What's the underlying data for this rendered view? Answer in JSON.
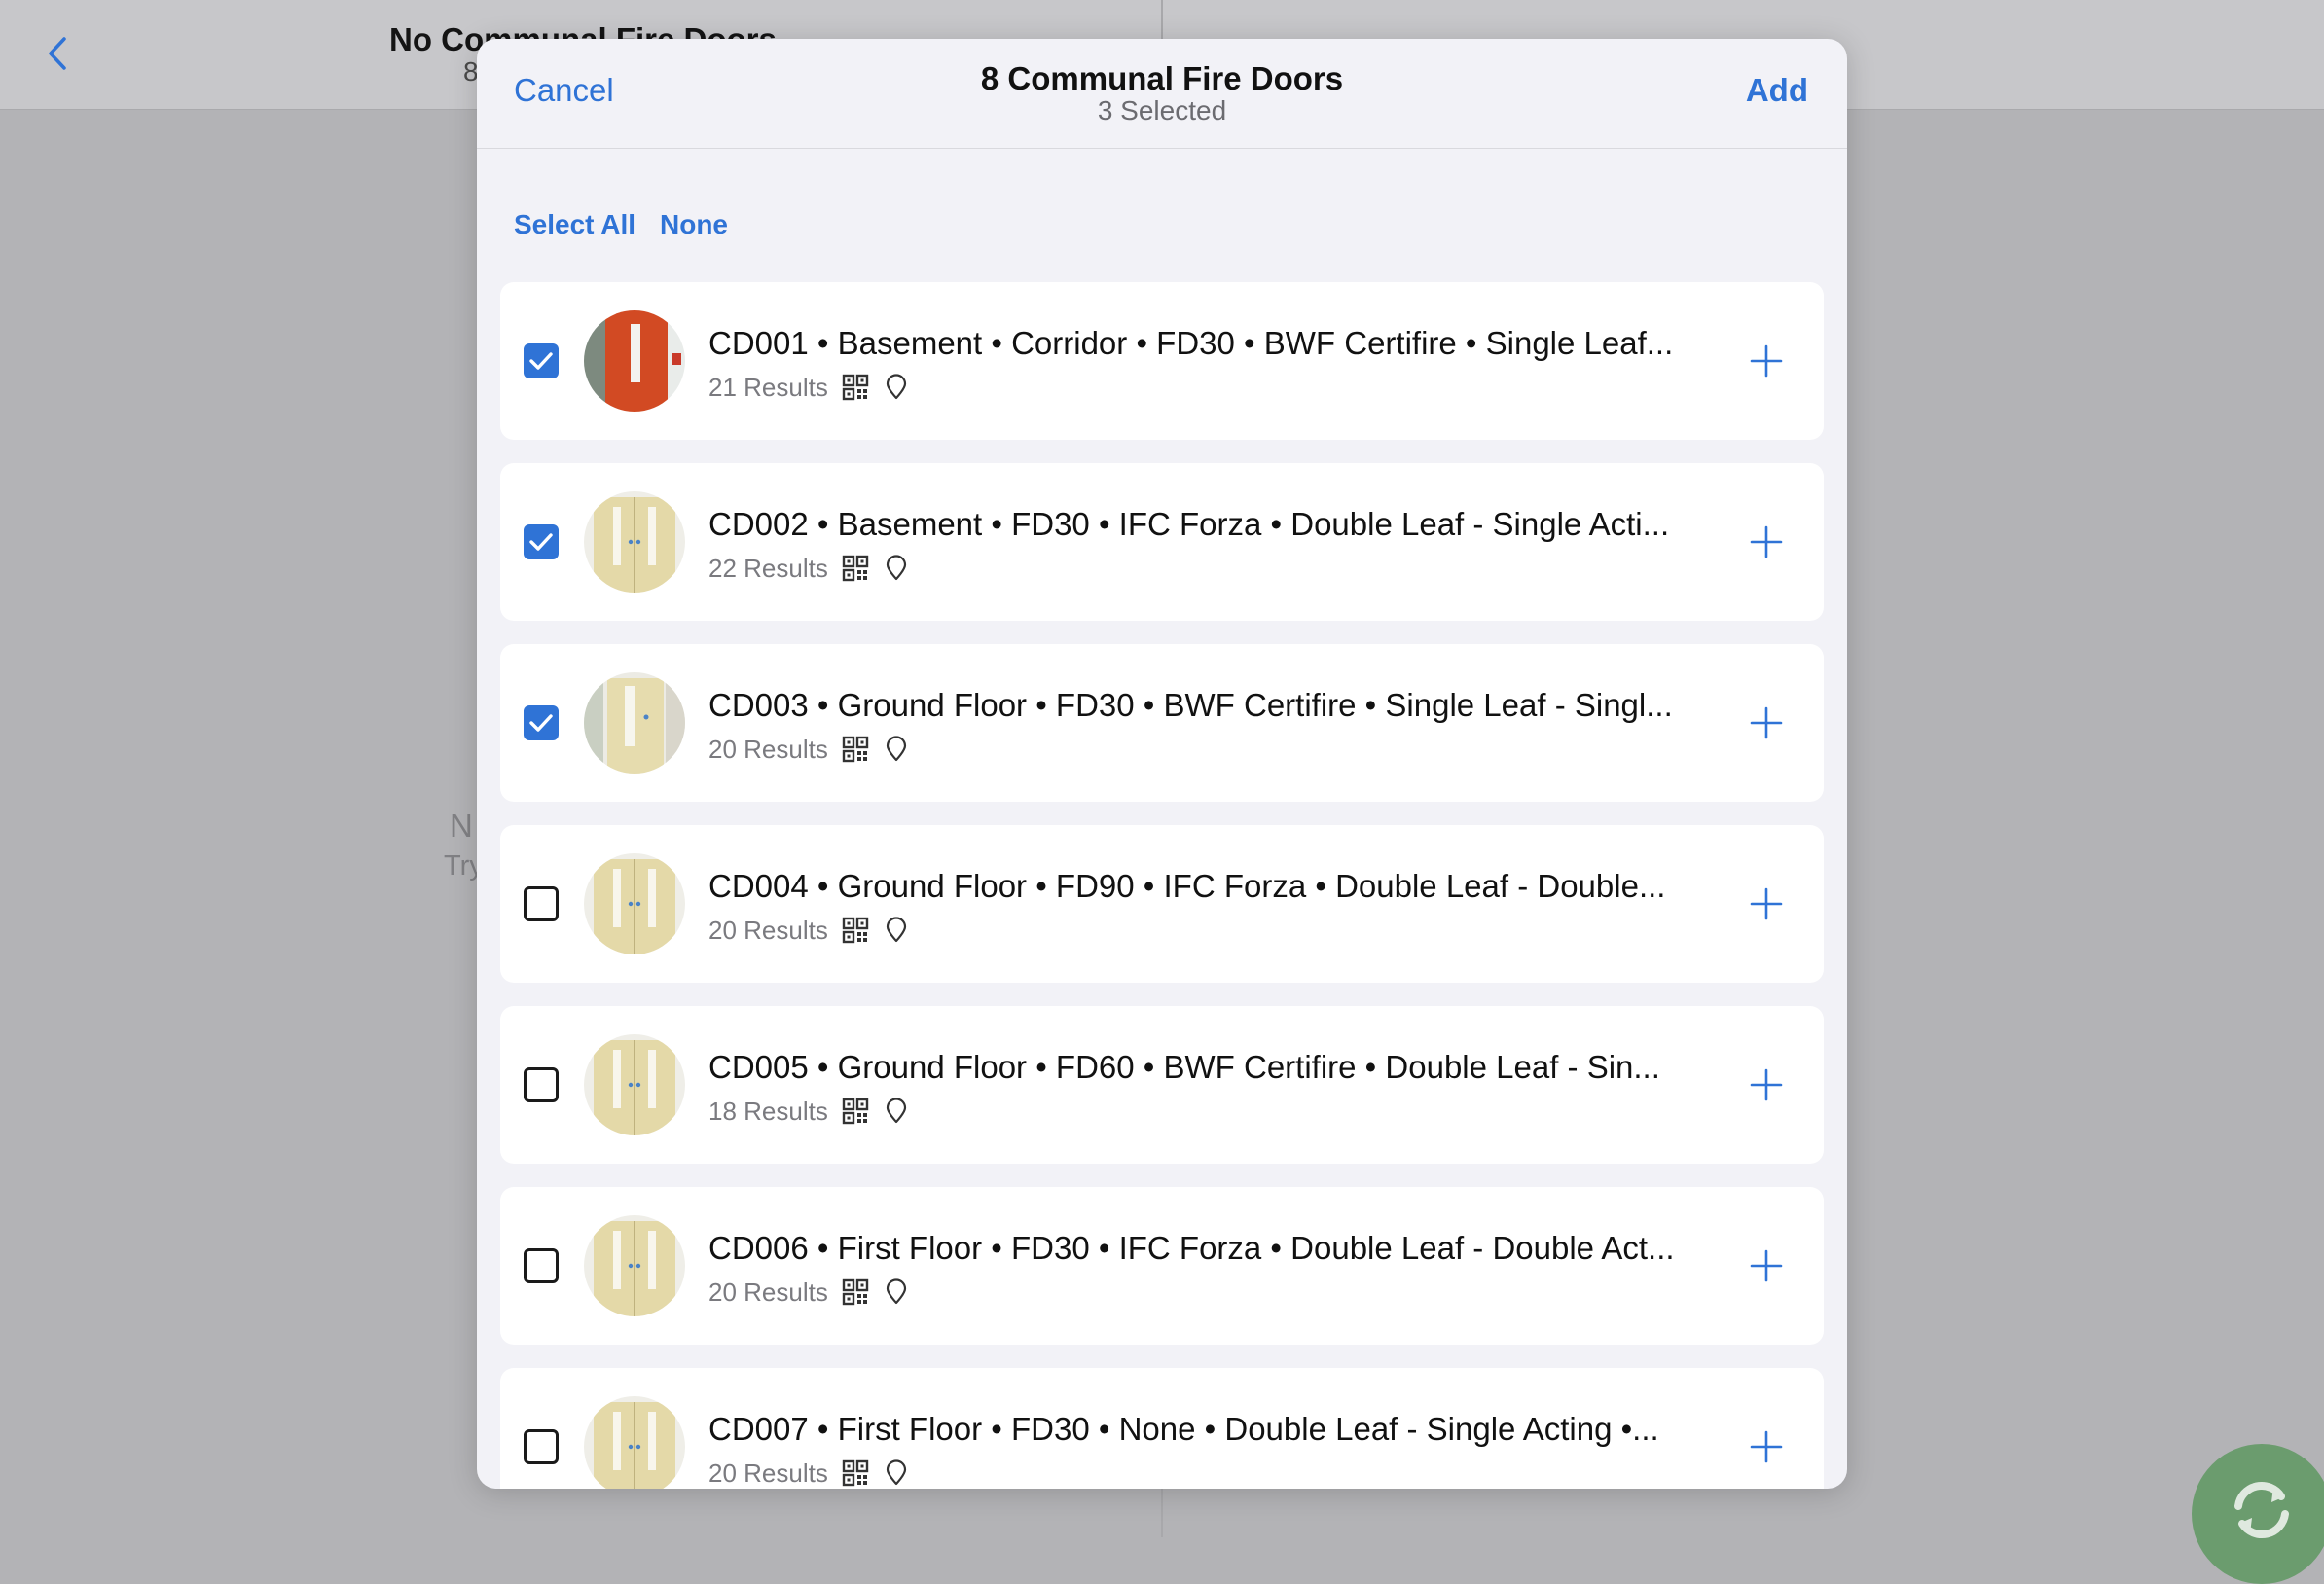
{
  "background": {
    "title": "No Communal Fire Doors",
    "subtitle": "8",
    "empty_title": "N",
    "empty_subtitle": "Try"
  },
  "modal": {
    "cancel_label": "Cancel",
    "title": "8 Communal Fire Doors",
    "subtitle": "3 Selected",
    "add_label": "Add",
    "select_all_label": "Select All",
    "select_none_label": "None"
  },
  "doors": [
    {
      "title": "CD001 • Basement • Corridor • FD30 • BWF Certifire • Single Leaf...",
      "results": "21 Results",
      "checked": true,
      "thumb": "red-door"
    },
    {
      "title": "CD002 • Basement • FD30 • IFC Forza • Double Leaf - Single Acti...",
      "results": "22 Results",
      "checked": true,
      "thumb": "double-door"
    },
    {
      "title": "CD003 • Ground Floor • FD30 • BWF Certifire • Single Leaf - Singl...",
      "results": "20 Results",
      "checked": true,
      "thumb": "single-door"
    },
    {
      "title": "CD004 • Ground Floor • FD90 • IFC Forza • Double Leaf - Double...",
      "results": "20 Results",
      "checked": false,
      "thumb": "double-door"
    },
    {
      "title": "CD005 • Ground Floor • FD60 • BWF Certifire • Double Leaf - Sin...",
      "results": "18 Results",
      "checked": false,
      "thumb": "double-door"
    },
    {
      "title": "CD006 • First Floor • FD30 • IFC Forza • Double Leaf - Double Act...",
      "results": "20 Results",
      "checked": false,
      "thumb": "double-door"
    },
    {
      "title": "CD007 • First Floor • FD30 • None • Double Leaf - Single Acting •...",
      "results": "20 Results",
      "checked": false,
      "thumb": "double-door"
    }
  ],
  "colors": {
    "accent": "#2f73d6",
    "sync_fab": "#6b9c6e"
  }
}
